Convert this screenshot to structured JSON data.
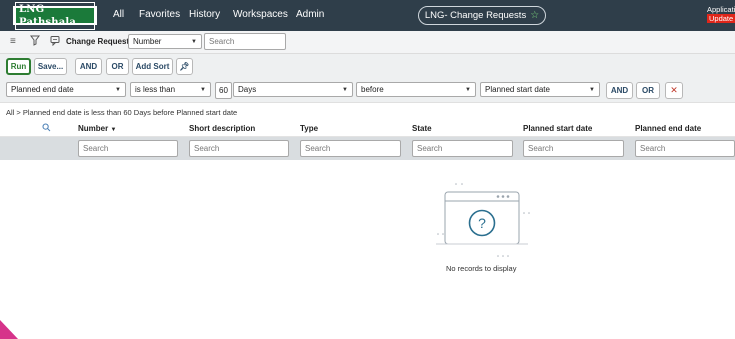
{
  "nav": {
    "logo_text": "LNG Pathshala",
    "items": [
      "All",
      "Favorites",
      "History",
      "Workspaces",
      "Admin"
    ],
    "title": "LNG- Change Requests",
    "app_note": "Applicati",
    "update_note": "Update s"
  },
  "listbar": {
    "title": "Change Requests",
    "field_select": "Number",
    "search_placeholder": "Search"
  },
  "buttons": {
    "run": "Run",
    "save": "Save...",
    "and": "AND",
    "or": "OR",
    "add_sort": "Add Sort"
  },
  "condition": {
    "field": "Planned end date",
    "operator": "is less than",
    "quantity": "60",
    "unit": "Days",
    "relation": "before",
    "target": "Planned start date",
    "and": "AND",
    "or": "OR"
  },
  "breadcrumb": "All > Planned end date is less than 60 Days before Planned start date",
  "table": {
    "columns": [
      "Number",
      "Short description",
      "Type",
      "State",
      "Planned start date",
      "Planned end date"
    ],
    "search_placeholder": "Search",
    "sort_indicator": "▼",
    "empty_message": "No records to display"
  },
  "colors": {
    "nav_bg": "#2f3e4a",
    "run_green": "#2e7d32",
    "update_red": "#e0261a",
    "search_row_bg": "#d9dde0"
  }
}
